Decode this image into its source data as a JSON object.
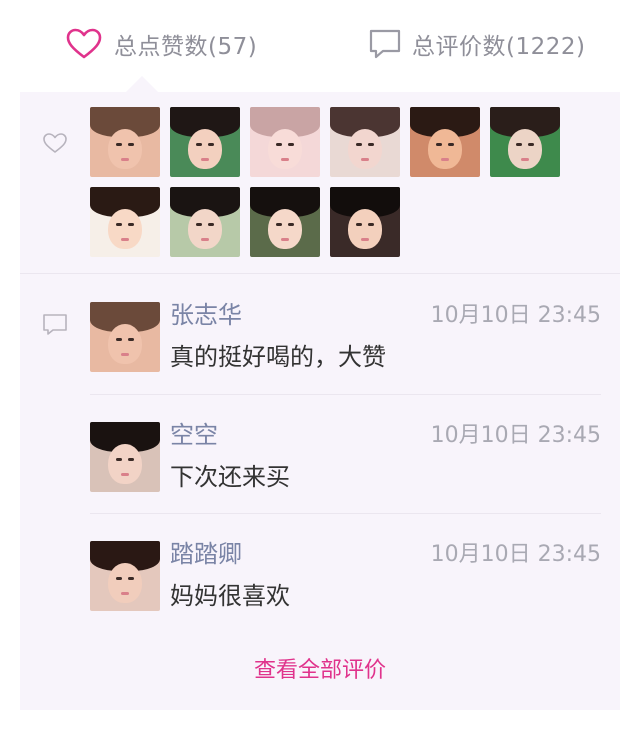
{
  "tabs": {
    "likes": {
      "label": "总点赞数(57)",
      "icon": "heart-icon",
      "active_color": "#e0338c"
    },
    "comments": {
      "label": "总评价数(1222)",
      "icon": "speech-bubble-icon"
    }
  },
  "likes": {
    "icon": "heart-outline-icon",
    "avatars": [
      {
        "bg": "#e8b9a2",
        "skin": "#f0c3ad",
        "hair": "#6b4a3a"
      },
      {
        "bg": "#4a8a58",
        "skin": "#f3d0bf",
        "hair": "#1f1715"
      },
      {
        "bg": "#f4d8d8",
        "skin": "#f8dcd8",
        "hair": "#c9a4a4"
      },
      {
        "bg": "#e9d9d4",
        "skin": "#f2d6cf",
        "hair": "#4b3532"
      },
      {
        "bg": "#d08a6a",
        "skin": "#f0b896",
        "hair": "#2b1a14"
      },
      {
        "bg": "#3e8a4c",
        "skin": "#ecd4c6",
        "hair": "#2a1e1a"
      },
      {
        "bg": "#f6efe8",
        "skin": "#f8d9c6",
        "hair": "#2a1a14"
      },
      {
        "bg": "#b7c9a8",
        "skin": "#f2d6c8",
        "hair": "#1a1412"
      },
      {
        "bg": "#5b6b4a",
        "skin": "#f5d8c9",
        "hair": "#15100e"
      },
      {
        "bg": "#3a2a28",
        "skin": "#f3d0bd",
        "hair": "#120d0c"
      }
    ]
  },
  "comments": {
    "icon": "comment-outline-icon",
    "items": [
      {
        "name": "张志华",
        "time": "10月10日 23:45",
        "text": "真的挺好喝的，大赞",
        "avatar": {
          "bg": "#e8b9a2",
          "skin": "#f0c3ad",
          "hair": "#6b4a3a"
        }
      },
      {
        "name": "空空",
        "time": "10月10日 23:45",
        "text": "下次还来买",
        "avatar": {
          "bg": "#d9c2b8",
          "skin": "#f2d3c6",
          "hair": "#1a1210"
        }
      },
      {
        "name": "踏踏卿",
        "time": "10月10日 23:45",
        "text": "妈妈很喜欢",
        "avatar": {
          "bg": "#e4c8bd",
          "skin": "#f1cdbc",
          "hair": "#2a1814"
        }
      }
    ],
    "view_all_label": "查看全部评价"
  }
}
